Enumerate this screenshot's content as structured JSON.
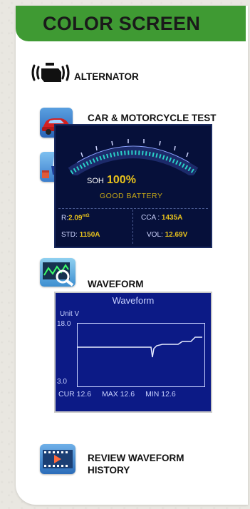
{
  "header": {
    "title": "COLOR SCREEN"
  },
  "features": [
    {
      "label": "ALTERNATOR",
      "icon": "engine-warning-icon"
    },
    {
      "label": "CAR & MOTORCYCLE TEST",
      "icon": "car-icon"
    },
    {
      "label": "WAVEFORM",
      "icon": "waveform-magnifier-icon"
    },
    {
      "label_line1": "REVIEW WAVEFORM",
      "label_line2": "HISTORY",
      "icon": "video-history-icon"
    }
  ],
  "battery_screen": {
    "soh_label": "SOH",
    "soh_value": "100%",
    "status": "GOOD BATTERY",
    "r_label": "R:",
    "r_value": "2.09",
    "r_unit": "mΩ",
    "cca_label": "CCA :",
    "cca_value": "1435A",
    "std_label": "STD:",
    "std_value": "1150A",
    "vol_label": "VOL:",
    "vol_value": "12.69V"
  },
  "waveform_screen": {
    "title": "Waveform",
    "unit": "Unit  V",
    "y_max": "18.0",
    "y_min": "3.0",
    "cur": "CUR 12.6",
    "max": "MAX 12.6",
    "min": "MIN 12.6"
  },
  "colors": {
    "header_green": "#3f9a33",
    "gauge_teal": "#2ad1c8",
    "value_yellow": "#e8c21c",
    "waveform_blue": "#0c1a86"
  }
}
